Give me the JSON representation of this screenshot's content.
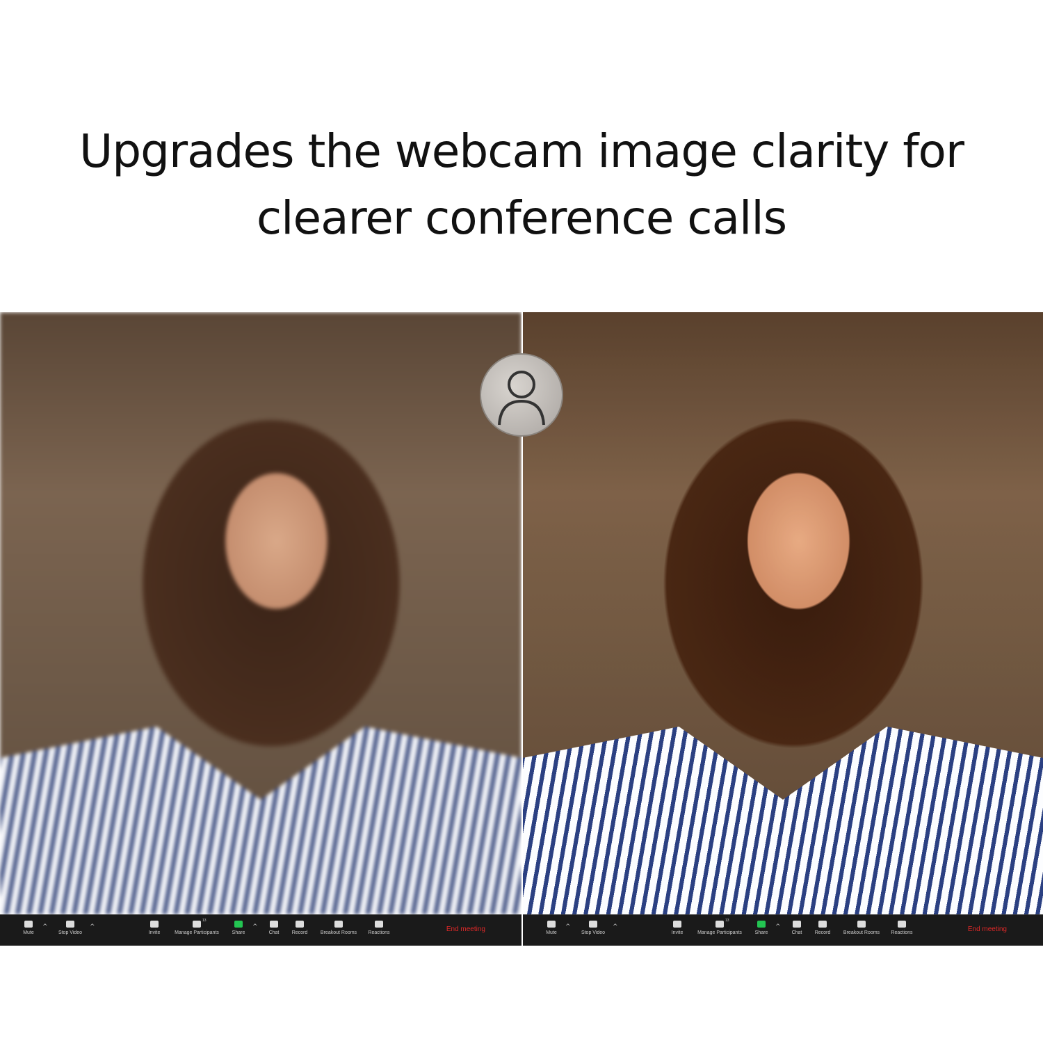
{
  "headline": {
    "line1": "Upgrades the webcam image clarity for",
    "line2": "clearer conference calls"
  },
  "badge_icon": "user-icon",
  "toolbar": {
    "items": [
      {
        "label": "Mute",
        "icon": "microphone-icon",
        "caret": true
      },
      {
        "label": "Stop Video",
        "icon": "video-camera-icon",
        "caret": true
      },
      {
        "label": "Invite",
        "icon": "add-user-icon"
      },
      {
        "label": "Manage Participants",
        "icon": "participants-icon",
        "count": "13"
      },
      {
        "label": "Share",
        "icon": "share-screen-icon",
        "caret": true,
        "accent": "#23c552"
      },
      {
        "label": "Chat",
        "icon": "chat-icon"
      },
      {
        "label": "Record",
        "icon": "record-icon"
      },
      {
        "label": "Breakout Rooms",
        "icon": "breakout-rooms-icon"
      },
      {
        "label": "Reactions",
        "icon": "reactions-icon"
      }
    ],
    "end_label": "End meeting",
    "end_color": "#e02828"
  }
}
